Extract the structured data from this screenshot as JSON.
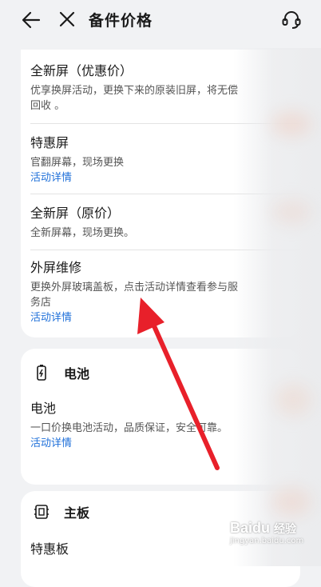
{
  "header": {
    "title": "备件价格",
    "back_icon": "arrow-left-icon",
    "close_icon": "close-icon",
    "service_icon": "customer-service-icon"
  },
  "screen_section": {
    "items": [
      {
        "title": "全新屏（优惠价）",
        "desc": "优享换屏活动，更换下来的原装旧屏，将无偿回收 。"
      },
      {
        "title": "特惠屏",
        "desc": "官翻屏幕，现场更换",
        "link": "活动详情"
      },
      {
        "title": "全新屏（原价）",
        "desc": "全新屏幕，现场更换。"
      },
      {
        "title": "外屏维修",
        "desc": "更换外屏玻璃盖板，点击活动详情查看参与服务店",
        "link": "活动详情"
      }
    ]
  },
  "battery_section": {
    "heading": "电池",
    "heading_icon": "battery-icon",
    "item": {
      "title": "电池",
      "desc": "一口价换电池活动，品质保证，安全可靠。",
      "link": "活动详情"
    }
  },
  "board_section": {
    "heading": "主板",
    "heading_icon": "motherboard-icon",
    "item": {
      "title": "特惠板"
    }
  },
  "watermark": {
    "brand": "Baidu",
    "text": "经验",
    "url": "jingyan.baidu.com"
  },
  "colors": {
    "link": "#1e6fd9",
    "arrow": "#e8202a",
    "background": "#f1f2f4"
  }
}
